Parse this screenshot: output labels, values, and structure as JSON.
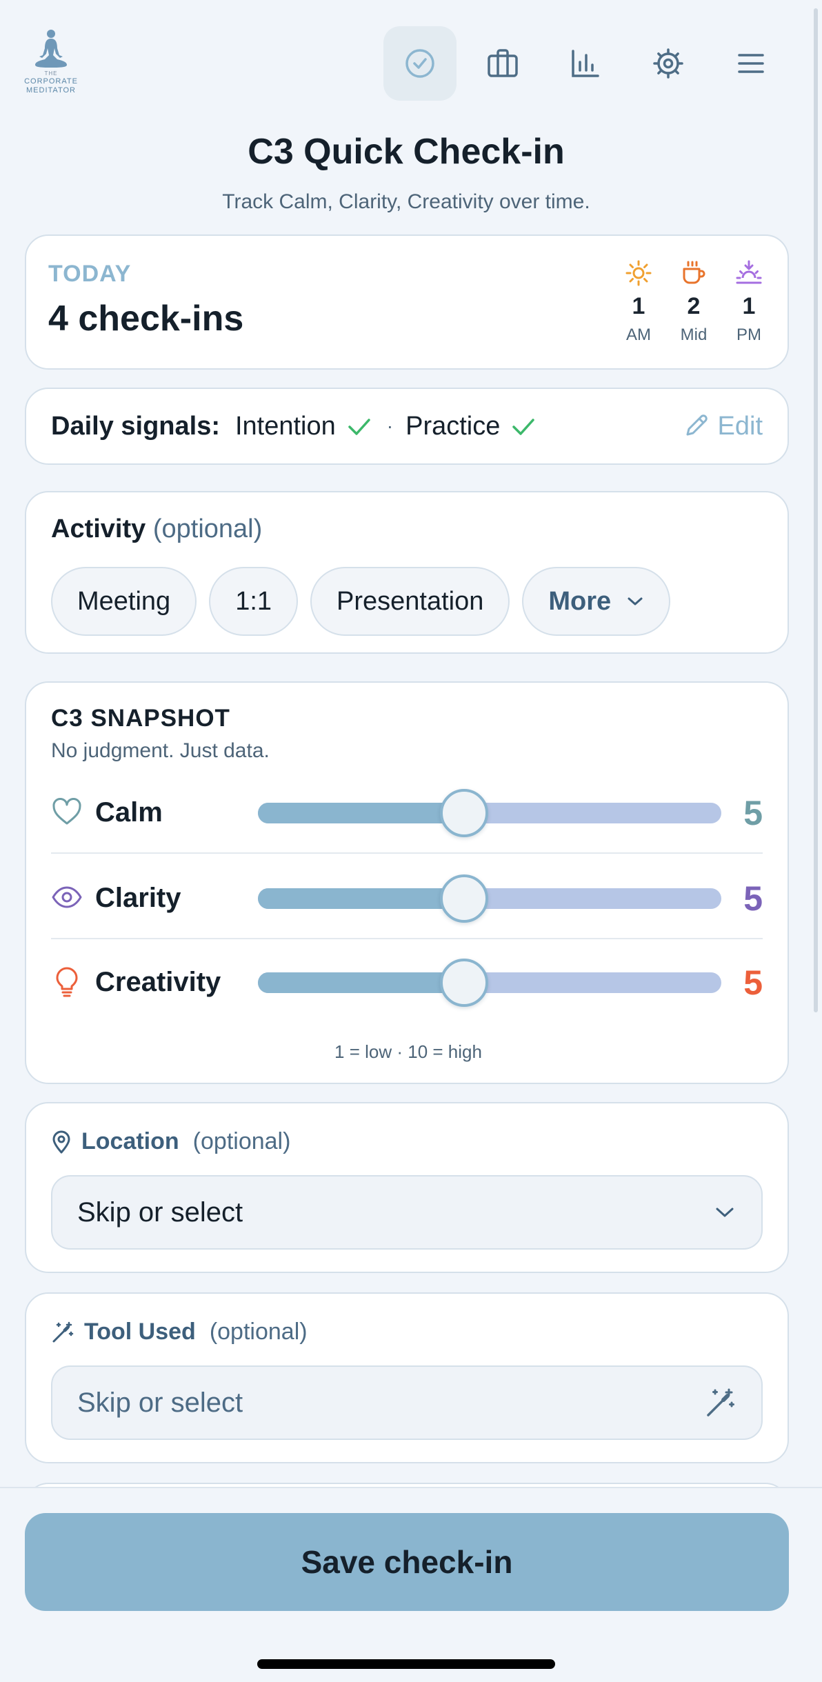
{
  "brand": {
    "logo_small": "THE",
    "logo_line1": "CORPORATE",
    "logo_line2": "MEDITATOR"
  },
  "nav": [
    {
      "icon": "check-circle-icon",
      "active": true
    },
    {
      "icon": "briefcase-icon",
      "active": false
    },
    {
      "icon": "bar-chart-icon",
      "active": false
    },
    {
      "icon": "gear-icon",
      "active": false
    },
    {
      "icon": "menu-icon",
      "active": false
    }
  ],
  "page": {
    "title": "C3 Quick Check-in",
    "subtitle": "Track Calm, Clarity, Creativity over time."
  },
  "today": {
    "label": "TODAY",
    "count_text": "4 check-ins",
    "slots": [
      {
        "icon": "sun-icon",
        "color": "#f0a030",
        "count": "1",
        "label": "AM"
      },
      {
        "icon": "coffee-icon",
        "color": "#e8742c",
        "count": "2",
        "label": "Mid"
      },
      {
        "icon": "sunset-icon",
        "color": "#a56ee0",
        "count": "1",
        "label": "PM"
      }
    ]
  },
  "signals": {
    "label": "Daily signals:",
    "items": [
      {
        "name": "Intention",
        "done": true
      },
      {
        "name": "Practice",
        "done": true
      }
    ],
    "separator": "·",
    "edit_label": "Edit",
    "check_color": "#3cb86a"
  },
  "activity": {
    "title": "Activity",
    "optional": "(optional)",
    "chips": [
      "Meeting",
      "1:1",
      "Presentation"
    ],
    "more_label": "More"
  },
  "snapshot": {
    "title": "C3 SNAPSHOT",
    "subtitle": "No judgment. Just data.",
    "scale_min": 1,
    "scale_max": 10,
    "metrics": [
      {
        "key": "calm",
        "label": "Calm",
        "icon": "heart-icon",
        "value": 5,
        "display": "5",
        "color": "#6f9ea6"
      },
      {
        "key": "clarity",
        "label": "Clarity",
        "icon": "eye-icon",
        "value": 5,
        "display": "5",
        "color": "#7b63b8"
      },
      {
        "key": "creativity",
        "label": "Creativity",
        "icon": "lightbulb-icon",
        "value": 5,
        "display": "5",
        "color": "#ec5f3a"
      }
    ],
    "hint": "1 = low · 10 = high"
  },
  "location": {
    "label": "Location",
    "optional": "(optional)",
    "value": "Skip or select"
  },
  "tool": {
    "label": "Tool Used",
    "optional": "(optional)",
    "placeholder": "Skip or select"
  },
  "save_label": "Save check-in"
}
